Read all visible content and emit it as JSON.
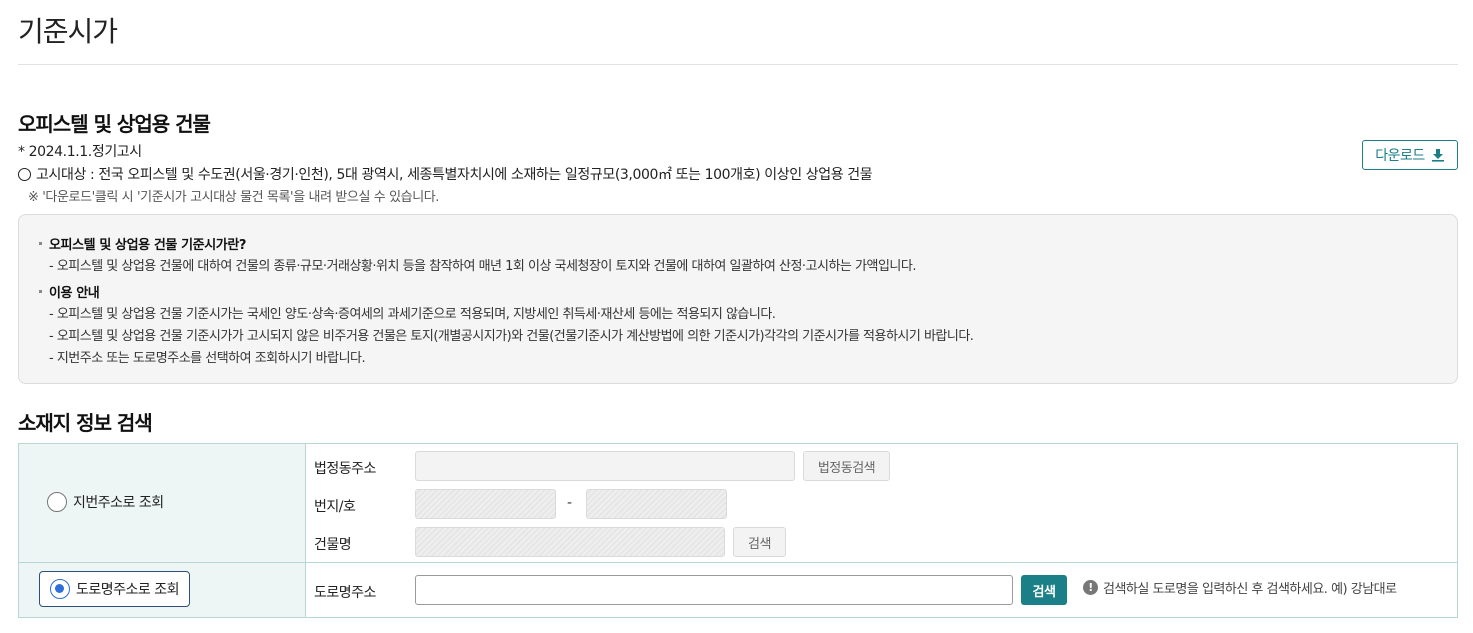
{
  "page": {
    "title": "기준시가"
  },
  "section": {
    "title": "오피스텔 및 상업용 건물",
    "date_line": "* 2024.1.1.정기고시",
    "target_line": "고시대상 : 전국 오피스텔 및 수도권(서울·경기·인천), 5대 광역시, 세종특별자치시에 소재하는 일정규모(3,000㎡ 또는 100개호) 이상인 상업용 건물",
    "note_line": "※ '다운로드'클릭 시 '기준시가 고시대상 물건 목록'을 내려 받으실 수 있습니다.",
    "download_label": "다운로드"
  },
  "info_box": {
    "blocks": [
      {
        "heading": "오피스텔 및 상업용 건물 기준시가란?",
        "lines": [
          "- 오피스텔 및 상업용 건물에 대하여 건물의 종류·규모·거래상황·위치 등을 참작하여 매년 1회 이상 국세청장이 토지와 건물에 대하여 일괄하여 산정·고시하는 가액입니다."
        ]
      },
      {
        "heading": "이용 안내",
        "lines": [
          "- 오피스텔 및 상업용 건물 기준시가는 국세인 양도·상속·증여세의 과세기준으로 적용되며, 지방세인 취득세·재산세 등에는 적용되지 않습니다.",
          "- 오피스텔 및 상업용 건물 기준시가가 고시되지 않은 비주거용 건물은 토지(개별공시지가)와 건물(건물기준시가 계산방법에 의한 기준시가)각각의 기준시가를 적용하시기 바랍니다.",
          "- 지번주소 또는 도로명주소를 선택하여 조회하시기 바랍니다."
        ]
      }
    ]
  },
  "search": {
    "title": "소재지 정보 검색",
    "jibun": {
      "radio_label": "지번주소로 조회",
      "selected": false,
      "legal_dong_label": "법정동주소",
      "legal_dong_button": "법정동검색",
      "lot_label": "번지/호",
      "lot_separator": "-",
      "building_label": "건물명",
      "building_button": "검색"
    },
    "road": {
      "radio_label": "도로명주소로 조회",
      "selected": true,
      "address_label": "도로명주소",
      "address_value": "",
      "search_button": "검색",
      "hint": "검색하실 도로명을 입력하신 후 검색하세요. 예) 강남대로"
    }
  },
  "colors": {
    "accent": "#1a7f86",
    "radio_on": "#2f6fd9",
    "table_border": "#b9d6d6",
    "label_cell_bg": "#eef6f5"
  }
}
